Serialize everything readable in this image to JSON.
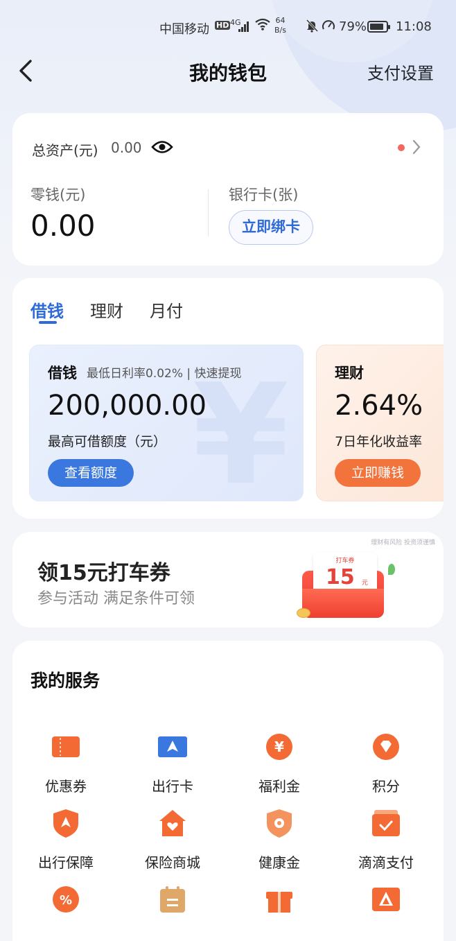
{
  "status_bar": {
    "carrier": "中国移动",
    "hd": "HD",
    "network": "4G",
    "speed_value": "64",
    "speed_unit": "B/s",
    "battery": "79%",
    "time": "11:08"
  },
  "header": {
    "title": "我的钱包",
    "settings": "支付设置"
  },
  "assets": {
    "total_label": "总资产(元)",
    "total_value": "0.00",
    "change_label": "零钱(元)",
    "change_value": "0.00",
    "bank_card_label": "银行卡(张)",
    "bind_card_button": "立即绑卡"
  },
  "finance": {
    "tabs": [
      "借钱",
      "理财",
      "月付"
    ],
    "active_tab": 0,
    "loan": {
      "title": "借钱",
      "subtitle": "最低日利率0.02% | 快速提现",
      "amount": "200,000.00",
      "desc": "最高可借额度（元）",
      "button": "查看额度",
      "background_glyph": "¥"
    },
    "wealth": {
      "title": "理财",
      "rate": "2.64%",
      "desc": "7日年化收益率",
      "button": "立即赚钱"
    }
  },
  "promo": {
    "risk_note": "理财有风险 投资须谨慎",
    "title": "领15元打车券",
    "subtitle": "参与活动 满足条件可领",
    "coupon_label": "打车券",
    "coupon_value": "15",
    "coupon_unit": "元",
    "carousel_active_index": 2
  },
  "services": {
    "title": "我的服务",
    "items": [
      {
        "label": "优惠券",
        "icon": "coupon-icon"
      },
      {
        "label": "出行卡",
        "icon": "travel-card-icon"
      },
      {
        "label": "福利金",
        "icon": "yuan-coin-icon"
      },
      {
        "label": "积分",
        "icon": "points-gem-icon"
      },
      {
        "label": "出行保障",
        "icon": "travel-shield-icon"
      },
      {
        "label": "保险商城",
        "icon": "insurance-house-icon"
      },
      {
        "label": "健康金",
        "icon": "health-shield-icon"
      },
      {
        "label": "滴滴支付",
        "icon": "wallet-check-icon"
      },
      {
        "label": "",
        "icon": "percent-icon"
      },
      {
        "label": "",
        "icon": "calendar-icon"
      },
      {
        "label": "",
        "icon": "gift-icon"
      },
      {
        "label": "",
        "icon": "triangle-card-icon"
      }
    ]
  },
  "colors": {
    "accent_blue": "#2f6bd6",
    "loan_button": "#3a78e0",
    "wealth_button": "#f2733c",
    "service_orange": "#f46a35",
    "red_dot": "#f4675c"
  }
}
